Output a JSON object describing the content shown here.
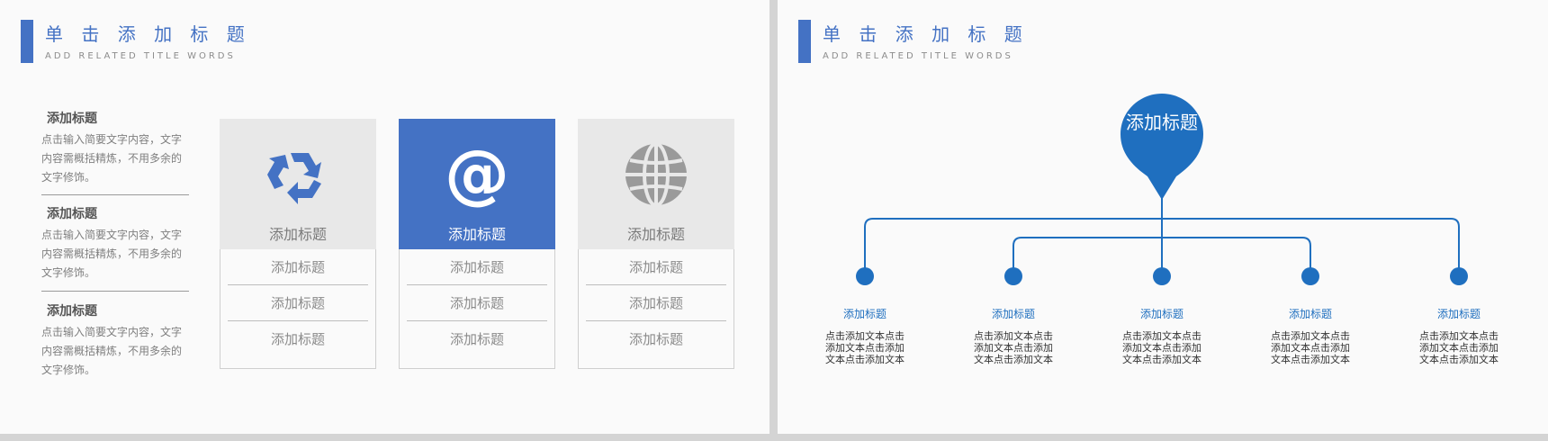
{
  "slide_left": {
    "title": "单 击 添 加 标 题",
    "subtitle": "ADD RELATED TITLE WORDS",
    "items": [
      {
        "title": "添加标题",
        "text": "点击输入简要文字内容，文字内容需概括精炼，不用多余的文字修饰。"
      },
      {
        "title": "添加标题",
        "text": "点击输入简要文字内容，文字内容需概括精炼，不用多余的文字修饰。"
      },
      {
        "title": "添加标题",
        "text": "点击输入简要文字内容，文字内容需概括精炼，不用多余的文字修饰。"
      }
    ],
    "cards": [
      {
        "icon": "recycle-icon",
        "label": "添加标题",
        "rows": [
          "添加标题",
          "添加标题",
          "添加标题"
        ]
      },
      {
        "icon": "at-sign-icon",
        "label": "添加标题",
        "rows": [
          "添加标题",
          "添加标题",
          "添加标题"
        ]
      },
      {
        "icon": "globe-icon",
        "label": "添加标题",
        "rows": [
          "添加标题",
          "添加标题",
          "添加标题"
        ]
      }
    ],
    "colors": {
      "accent": "#4472c4",
      "card_bg": "#e8e8e8",
      "icon_gray": "#9a9a9a"
    }
  },
  "slide_right": {
    "title": "单 击 添 加 标 题",
    "subtitle": "ADD RELATED TITLE WORDS",
    "center_label": "添加标题",
    "nodes": [
      {
        "title": "添加标题",
        "text": "点击添加文本点击添加文本点击添加文本点击添加文本"
      },
      {
        "title": "添加标题",
        "text": "点击添加文本点击添加文本点击添加文本点击添加文本"
      },
      {
        "title": "添加标题",
        "text": "点击添加文本点击添加文本点击添加文本点击添加文本"
      },
      {
        "title": "添加标题",
        "text": "点击添加文本点击添加文本点击添加文本点击添加文本"
      },
      {
        "title": "添加标题",
        "text": "点击添加文本点击添加文本点击添加文本点击添加文本"
      }
    ],
    "colors": {
      "accent": "#1f6fbf",
      "title": "#4472c4"
    }
  }
}
